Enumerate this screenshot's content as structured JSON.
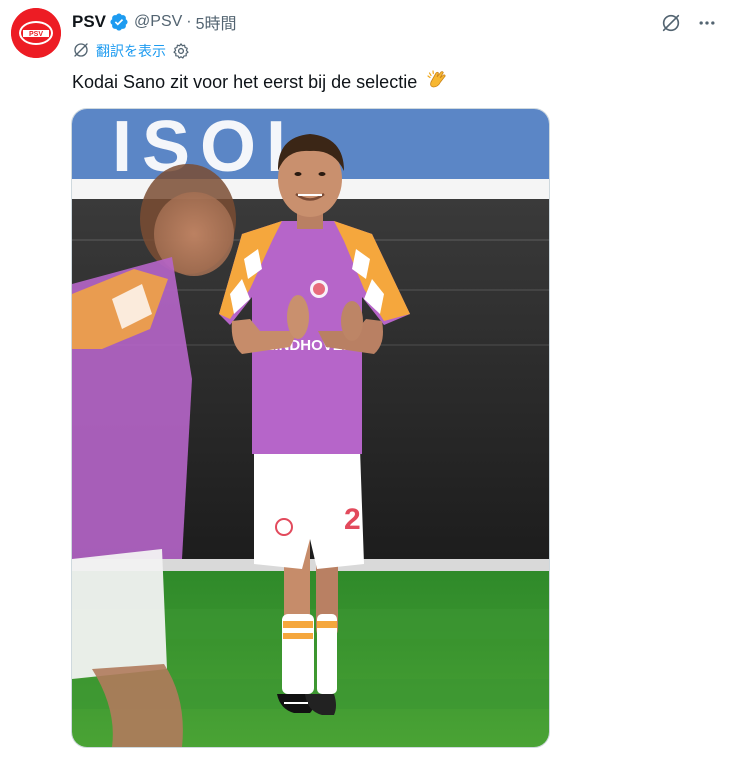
{
  "account": {
    "name": "PSV",
    "handle": "@PSV",
    "separator": "·",
    "time": "5時間",
    "avatar_color": "#ed1c24",
    "avatar_text": "PSV"
  },
  "translate": {
    "label": "翻訳を表示",
    "icon": "translate-off-icon",
    "settings_icon": "gear-icon"
  },
  "tweet": {
    "text": "Kodai Sano zit voor het eerst bij de selectie",
    "emoji": "clapping-hands-icon"
  },
  "media": {
    "kind": "photo",
    "subject": "player applauding on pitch",
    "banner_text": "ISOL",
    "shirt_text": "EINDHOVEN"
  },
  "colors": {
    "link": "#1d9bf0",
    "secondary": "#536471",
    "verified": "#1d9bf0",
    "shirt_purple": "#b665c9",
    "shirt_orange": "#f5a73d"
  }
}
